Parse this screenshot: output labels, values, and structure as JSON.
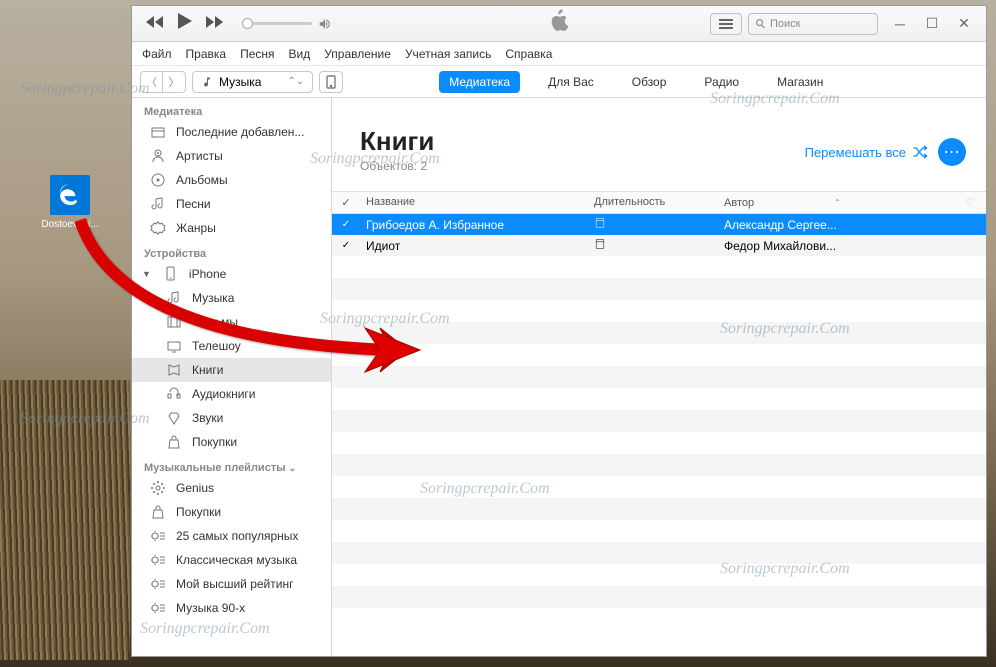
{
  "desktop": {
    "icon_label": "Dostoevski..."
  },
  "menubar": [
    "Файл",
    "Правка",
    "Песня",
    "Вид",
    "Управление",
    "Учетная запись",
    "Справка"
  ],
  "search": {
    "placeholder": "Поиск"
  },
  "media_selector": {
    "label": "Музыка"
  },
  "tabs": [
    {
      "label": "Медиатека",
      "active": true
    },
    {
      "label": "Для Вас"
    },
    {
      "label": "Обзор"
    },
    {
      "label": "Радио"
    },
    {
      "label": "Магазин"
    }
  ],
  "sidebar": {
    "sections": [
      {
        "title": "Медиатека",
        "items": [
          {
            "icon": "recent",
            "label": "Последние добавлен..."
          },
          {
            "icon": "artist",
            "label": "Артисты"
          },
          {
            "icon": "album",
            "label": "Альбомы"
          },
          {
            "icon": "song",
            "label": "Песни"
          },
          {
            "icon": "genre",
            "label": "Жанры"
          }
        ]
      },
      {
        "title": "Устройства",
        "device": {
          "label": "iPhone"
        },
        "items": [
          {
            "icon": "song",
            "label": "Музыка"
          },
          {
            "icon": "film",
            "label": "Фильмы"
          },
          {
            "icon": "tv",
            "label": "Телешоу"
          },
          {
            "icon": "book",
            "label": "Книги",
            "selected": true
          },
          {
            "icon": "audiobook",
            "label": "Аудиокниги"
          },
          {
            "icon": "tone",
            "label": "Звуки"
          },
          {
            "icon": "bag",
            "label": "Покупки"
          }
        ]
      },
      {
        "title": "Музыкальные плейлисты",
        "collapsible": true,
        "items": [
          {
            "icon": "genius",
            "label": "Genius"
          },
          {
            "icon": "bag",
            "label": "Покупки"
          },
          {
            "icon": "gear-list",
            "label": "25 самых популярных"
          },
          {
            "icon": "gear-list",
            "label": "Классическая музыка"
          },
          {
            "icon": "gear-list",
            "label": "Мой высший рейтинг"
          },
          {
            "icon": "gear-list",
            "label": "Музыка 90-х"
          }
        ]
      }
    ]
  },
  "content": {
    "title": "Книги",
    "subtitle": "Объектов: 2",
    "shuffle_label": "Перемешать все",
    "columns": {
      "name": "Название",
      "duration": "Длительность",
      "author": "Автор"
    },
    "rows": [
      {
        "name": "Грибоедов А. Избранное",
        "author": "Александр Сергее...",
        "selected": true
      },
      {
        "name": "Идиот",
        "author": "Федор Михайлови..."
      }
    ]
  },
  "watermark": "Soringpcrepair.Com"
}
